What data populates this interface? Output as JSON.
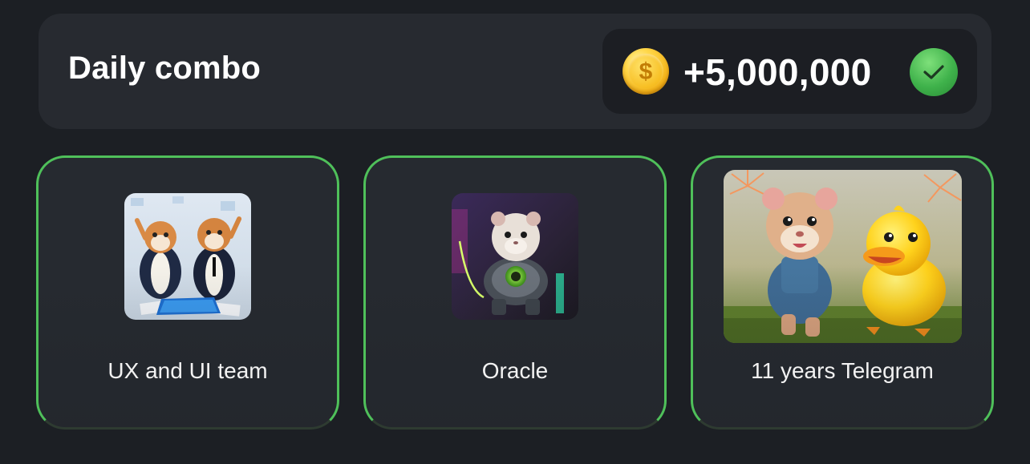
{
  "header": {
    "title": "Daily combo",
    "reward_amount": "+5,000,000",
    "coin_icon": "gold-coin-icon",
    "status_icon": "checkmark-icon"
  },
  "cards": [
    {
      "label": "UX and UI team",
      "image": "two hamsters in suits with tablet"
    },
    {
      "label": "Oracle",
      "image": "hamster in robotic exosuit"
    },
    {
      "label": "11 years Telegram",
      "image": "hamster and yellow duck with fireworks"
    }
  ],
  "colors": {
    "background": "#1c1f24",
    "panel": "#272a30",
    "accent_green": "#4fc05a",
    "coin_gold": "#f4b41a"
  }
}
